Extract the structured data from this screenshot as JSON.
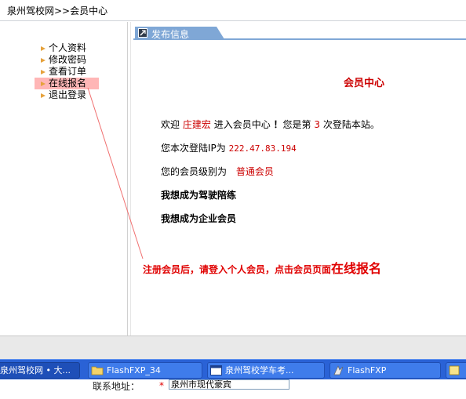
{
  "breadcrumb": "泉州驾校网>>会员中心",
  "menu": {
    "items": [
      {
        "label": "个人资料"
      },
      {
        "label": "修改密码"
      },
      {
        "label": "查看订单"
      },
      {
        "label": "在线报名"
      },
      {
        "label": "退出登录"
      }
    ],
    "active_index": 3
  },
  "tab": {
    "label": "发布信息",
    "icon": "edit-icon"
  },
  "content": {
    "title": "会员中心",
    "welcome_prefix": "欢迎",
    "username": "庄建宏",
    "welcome_mid": "进入会员中心",
    "welcome_exclaim": "！",
    "login_prefix": "您是第",
    "login_count": "3",
    "login_suffix": "次登陆本站。",
    "ip_label": "您本次登陆IP为",
    "ip_value": "222.47.83.194",
    "level_label": "您的会员级别为",
    "level_value": "普通会员",
    "link_coach": "我想成为驾驶陪练",
    "link_enterprise": "我想成为企业会员"
  },
  "callout": {
    "text_main": "注册会员后，请登入个人会员，点击会员页面",
    "text_big": "在线报名",
    "color": "#e00000"
  },
  "taskbar": {
    "buttons": [
      {
        "label": "泉州驾校网 • 大...",
        "icon": "ie-icon"
      },
      {
        "label": "FlashFXP_34",
        "icon": "folder-icon"
      },
      {
        "label": "泉州驾校学车考...",
        "icon": "window-icon"
      },
      {
        "label": "FlashFXP",
        "icon": "flashfxp-icon"
      }
    ]
  },
  "under_row": {
    "label": "联系地址：",
    "required_mark": "*",
    "input_value": "泉州市现代豪宾"
  },
  "colors": {
    "accent_red": "#cc0000",
    "tab_blue": "#7fa7d6",
    "taskbar_blue": "#2a62d6",
    "menu_highlight": "#ffb6b6"
  }
}
